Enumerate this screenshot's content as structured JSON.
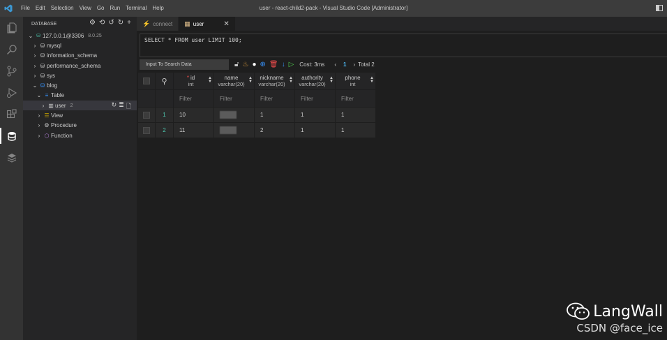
{
  "window": {
    "title": "user - react-child2-pack - Visual Studio Code [Administrator]",
    "menu": [
      "File",
      "Edit",
      "Selection",
      "View",
      "Go",
      "Run",
      "Terminal",
      "Help"
    ]
  },
  "activity_bar": {
    "icons": [
      "files-icon",
      "search-icon",
      "source-control-icon",
      "run-debug-icon",
      "extensions-icon",
      "database-icon",
      "database-stack-icon"
    ],
    "active": "database-icon"
  },
  "sidebar": {
    "header": "DATABASE",
    "connection": {
      "label": "127.0.0.1@3306",
      "version": "8.0.25"
    },
    "databases": [
      {
        "label": "mysql"
      },
      {
        "label": "information_schema"
      },
      {
        "label": "performance_schema"
      },
      {
        "label": "sys"
      },
      {
        "label": "blog"
      }
    ],
    "blog_children": {
      "table": "Table",
      "user": {
        "label": "user",
        "count": "2"
      },
      "view": "View",
      "procedure": "Procedure",
      "function": "Function"
    }
  },
  "tabs": [
    {
      "label": "connect",
      "active": false
    },
    {
      "label": "user",
      "active": true
    }
  ],
  "editor": {
    "sql": "SELECT * FROM user LIMIT 100;"
  },
  "toolbar": {
    "search_placeholder": "Input To Search Data",
    "cost": "Cost: 3ms",
    "page": "1",
    "total": "Total 2"
  },
  "grid": {
    "columns": [
      {
        "name": "id",
        "type": "int",
        "required": true
      },
      {
        "name": "name",
        "type": "varchar(20)",
        "required": false
      },
      {
        "name": "nickname",
        "type": "varchar(20)",
        "required": false
      },
      {
        "name": "authority",
        "type": "varchar(20)",
        "required": false
      },
      {
        "name": "phone",
        "type": "int",
        "required": false
      }
    ],
    "filter_placeholder": "Filter",
    "rows": [
      {
        "num": "1",
        "id": "10",
        "nickname": "1",
        "authority": "1",
        "phone": "1"
      },
      {
        "num": "2",
        "id": "11",
        "nickname": "2",
        "authority": "1",
        "phone": "1"
      }
    ]
  },
  "watermark": {
    "name": "LangWall",
    "sub": "CSDN @face_ice"
  },
  "colors": {
    "accent": "#007acc",
    "row_number": "#4ec9b0",
    "required": "#f14c4c",
    "page": "#4fc1ff"
  }
}
